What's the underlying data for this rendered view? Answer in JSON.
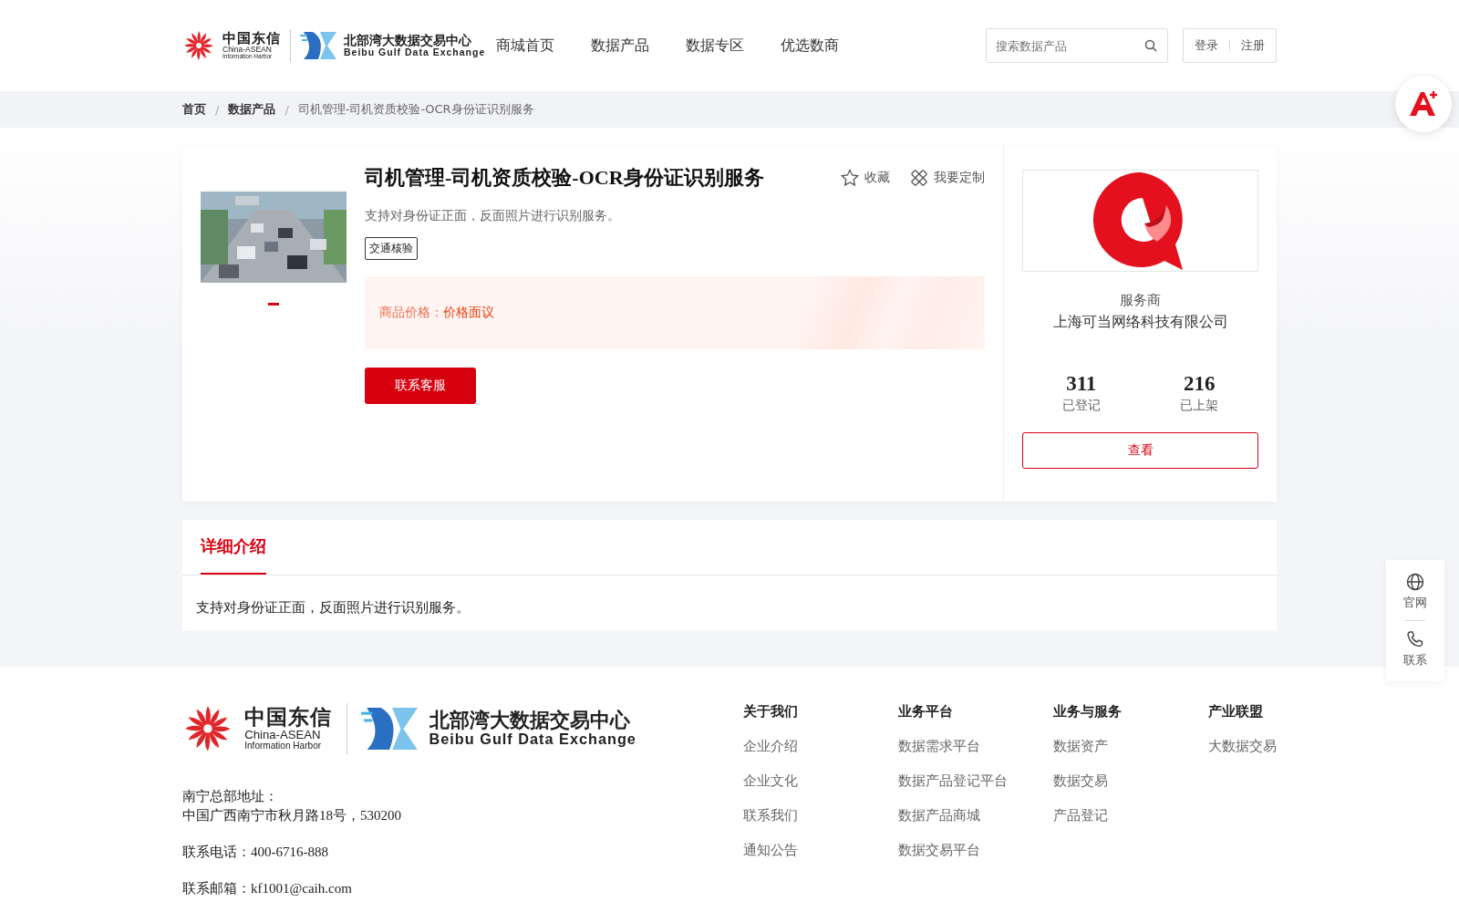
{
  "header": {
    "logo": {
      "brand_cn": "中国东信",
      "brand_en_1": "China-ASEAN",
      "brand_en_2": "Information Harbor",
      "exchange_cn": "北部湾大数据交易中心",
      "exchange_en": "Beibu Gulf Data Exchange"
    },
    "nav": [
      {
        "label": "商城首页",
        "selected": false
      },
      {
        "label": "数据产品",
        "selected": false
      },
      {
        "label": "数据专区",
        "selected": false
      },
      {
        "label": "优选数商",
        "selected": false
      }
    ],
    "search": {
      "placeholder": "搜索数据产品"
    },
    "auth": [
      "登录",
      "注册"
    ]
  },
  "breadcrumb": {
    "separator": "/",
    "items": [
      "首页",
      "数据产品",
      "司机管理-司机资质校验-OCR身份证识别服务"
    ]
  },
  "product": {
    "title": "司机管理-司机资质校验-OCR身份证识别服务",
    "actions": [
      {
        "kind": "favorite",
        "label": "收藏"
      },
      {
        "kind": "customize",
        "label": "我要定制"
      }
    ],
    "description": "支持对身份证正面，反面照片进行识别服务。",
    "tags": [
      "交通核验"
    ],
    "price_label": "商品价格：",
    "price_value": "价格面议",
    "contact_button": "联系客服",
    "gallery_dots": [
      {
        "selected": true
      }
    ]
  },
  "vendor": {
    "caption": "服务商",
    "name": "上海可当网络科技有限公司",
    "stats": [
      {
        "value": "311",
        "label": "已登记"
      },
      {
        "value": "216",
        "label": "已上架"
      }
    ],
    "button": "查看"
  },
  "details": {
    "tabs": [
      {
        "label": "详细介绍",
        "selected": true
      }
    ],
    "content": "支持对身份证正面，反面照片进行识别服务。"
  },
  "footer": {
    "logo": {
      "brand_cn": "中国东信",
      "brand_en_1": "China-ASEAN",
      "brand_en_2": "Information Harbor",
      "exchange_cn": "北部湾大数据交易中心",
      "exchange_en": "Beibu Gulf Data Exchange"
    },
    "address_label": "南宁总部地址：",
    "address": "中国广西南宁市秋月路18号，530200",
    "phone": "联系电话：400-6716-888",
    "email": "联系邮箱：kf1001@caih.com",
    "columns": [
      {
        "title": "关于我们",
        "links": [
          "企业介绍",
          "企业文化",
          "联系我们",
          "通知公告"
        ]
      },
      {
        "title": "业务平台",
        "links": [
          "数据需求平台",
          "数据产品登记平台",
          "数据产品商城",
          "数据交易平台"
        ]
      },
      {
        "title": "业务与服务",
        "links": [
          "数据资产",
          "数据交易",
          "产品登记"
        ]
      },
      {
        "title": "产业联盟",
        "links": [
          "大数据交易"
        ]
      }
    ]
  },
  "side_tools": [
    {
      "kind": "website",
      "label": "官网"
    },
    {
      "kind": "contact",
      "label": "联系"
    }
  ]
}
